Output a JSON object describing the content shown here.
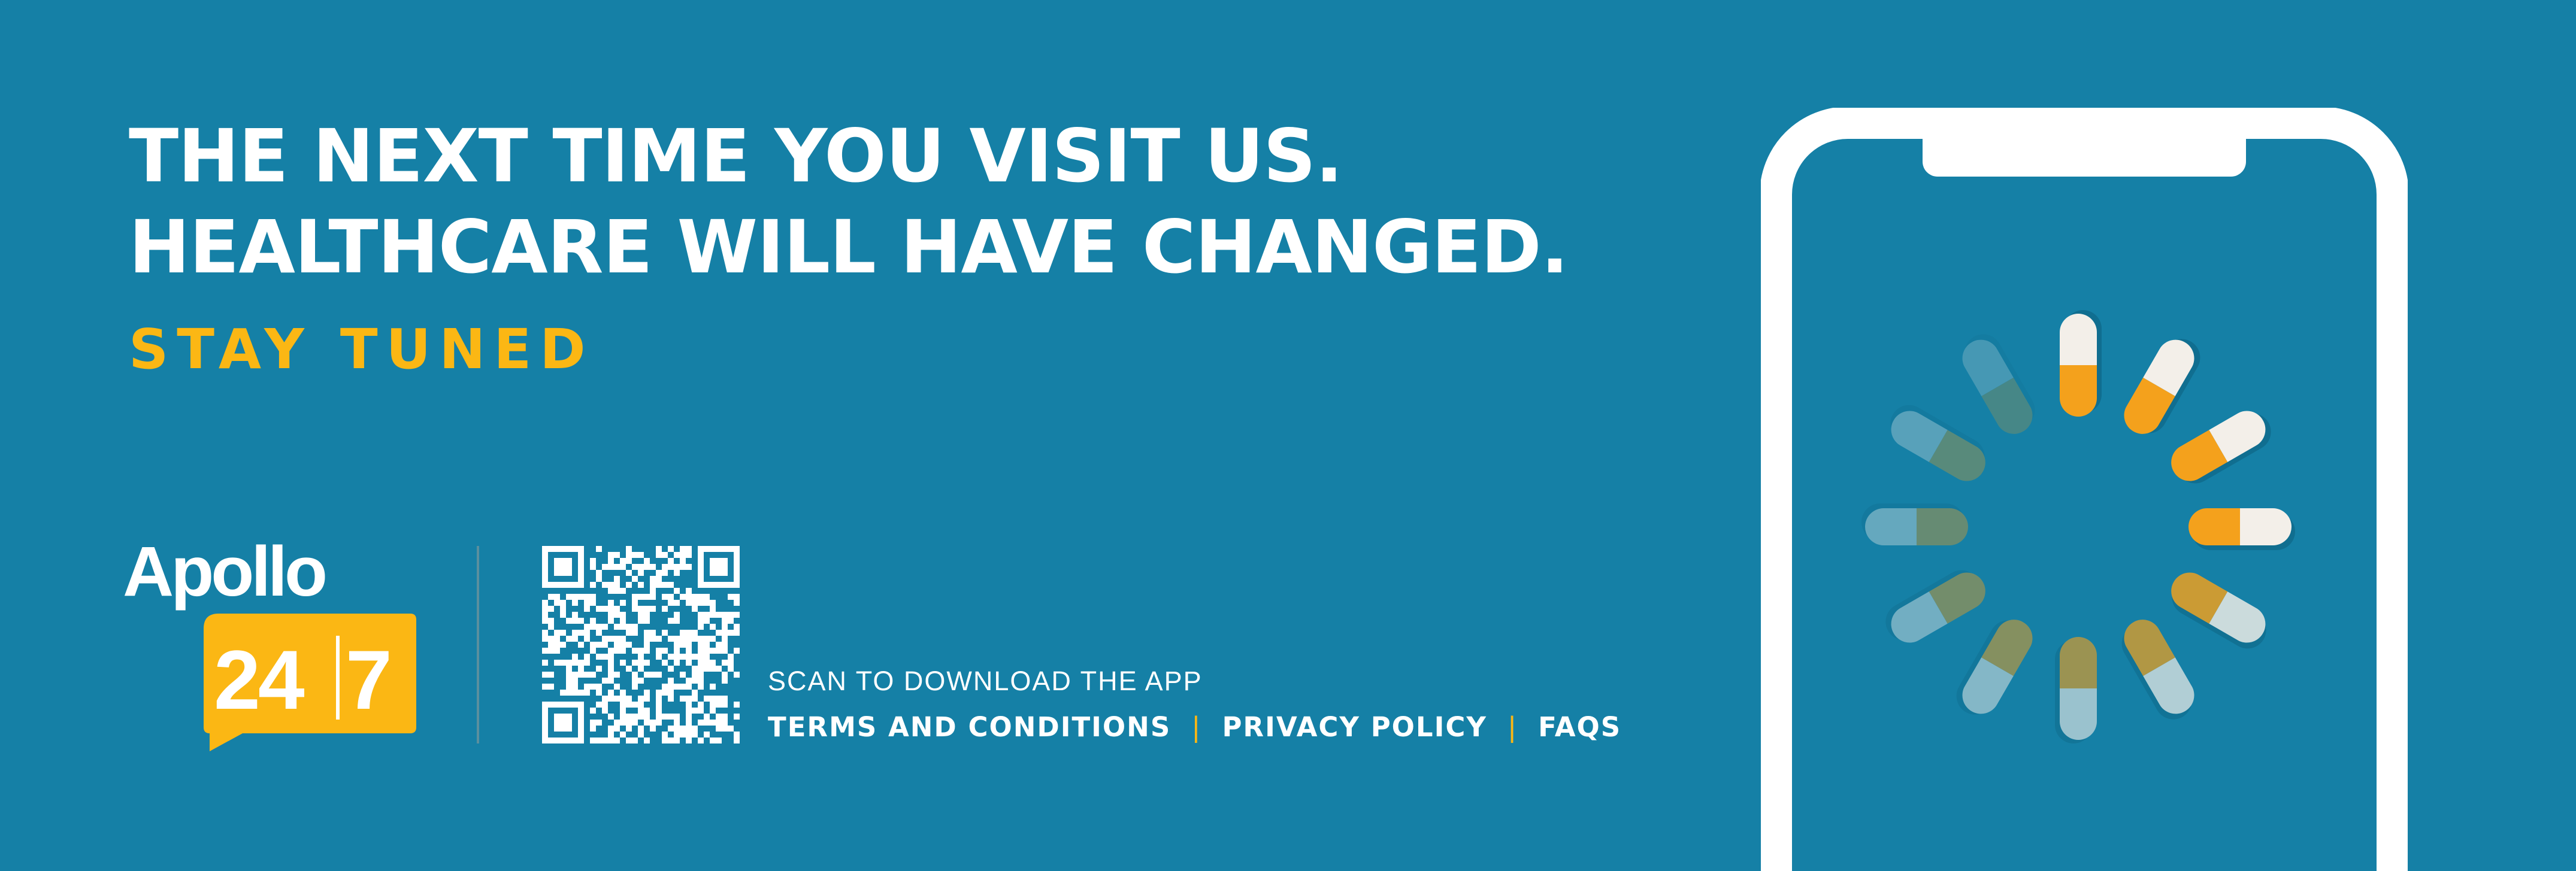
{
  "colors": {
    "background": "#1580a6",
    "accent": "#fbb714",
    "text": "#ffffff",
    "pill_orange": "#f4a11c",
    "pill_cream": "#f3efe9"
  },
  "headline": {
    "line1": "THE NEXT TIME YOU VISIT US.",
    "line2": "HEALTHCARE WILL HAVE CHANGED."
  },
  "tagline": "STAY TUNED",
  "brand": {
    "name": "Apollo",
    "badge_left": "24",
    "badge_right": "7"
  },
  "qr": {
    "icon": "qr-code-icon"
  },
  "scan_text": "SCAN TO DOWNLOAD THE APP",
  "links": {
    "terms": "TERMS AND CONDITIONS",
    "privacy": "PRIVACY POLICY",
    "faqs": "FAQS",
    "separator": "|"
  },
  "phone": {
    "icon": "smartphone-icon",
    "loader_icon": "capsule-loading-spinner-icon"
  }
}
